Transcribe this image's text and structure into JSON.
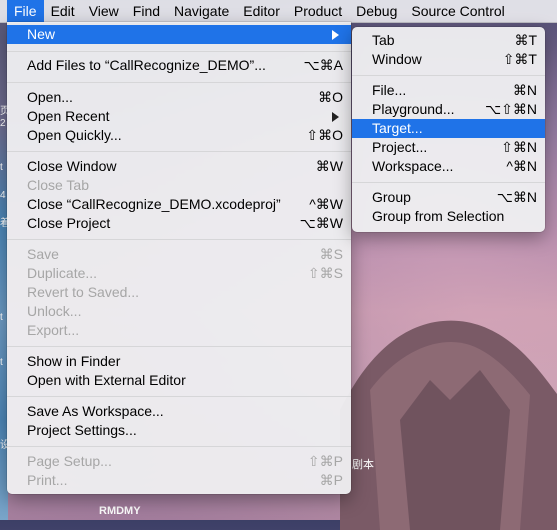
{
  "menubar": {
    "items": [
      "File",
      "Edit",
      "View",
      "Find",
      "Navigate",
      "Editor",
      "Product",
      "Debug",
      "Source Control"
    ]
  },
  "file_menu": {
    "new": "New",
    "add_files": {
      "label": "Add Files to “CallRecognize_DEMO”...",
      "shortcut": "⌥⌘A"
    },
    "open": {
      "label": "Open...",
      "shortcut": "⌘O"
    },
    "open_recent": {
      "label": "Open Recent"
    },
    "open_quickly": {
      "label": "Open Quickly...",
      "shortcut": "⇧⌘O"
    },
    "close_window": {
      "label": "Close Window",
      "shortcut": "⌘W"
    },
    "close_tab": {
      "label": "Close Tab"
    },
    "close_project_file": {
      "label": "Close “CallRecognize_DEMO.xcodeproj”",
      "shortcut": "^⌘W"
    },
    "close_project": {
      "label": "Close Project",
      "shortcut": "⌥⌘W"
    },
    "save": {
      "label": "Save",
      "shortcut": "⌘S"
    },
    "duplicate": {
      "label": "Duplicate...",
      "shortcut": "⇧⌘S"
    },
    "revert": {
      "label": "Revert to Saved..."
    },
    "unlock": {
      "label": "Unlock..."
    },
    "export": {
      "label": "Export..."
    },
    "show_in_finder": {
      "label": "Show in Finder"
    },
    "open_external": {
      "label": "Open with External Editor"
    },
    "save_workspace": {
      "label": "Save As Workspace..."
    },
    "project_settings": {
      "label": "Project Settings..."
    },
    "page_setup": {
      "label": "Page Setup...",
      "shortcut": "⇧⌘P"
    },
    "print": {
      "label": "Print...",
      "shortcut": "⌘P"
    }
  },
  "new_submenu": {
    "tab": {
      "label": "Tab",
      "shortcut": "⌘T"
    },
    "window": {
      "label": "Window",
      "shortcut": "⇧⌘T"
    },
    "file": {
      "label": "File...",
      "shortcut": "⌘N"
    },
    "playground": {
      "label": "Playground...",
      "shortcut": "⌥⇧⌘N"
    },
    "target": {
      "label": "Target..."
    },
    "project": {
      "label": "Project...",
      "shortcut": "⇧⌘N"
    },
    "workspace": {
      "label": "Workspace...",
      "shortcut": "^⌘N"
    },
    "group": {
      "label": "Group",
      "shortcut": "⌥⌘N"
    },
    "group_from_selection": {
      "label": "Group from Selection"
    }
  },
  "desktop": {
    "label": "RMDMY",
    "label2": "剧本",
    "left_chars": [
      "页",
      "2",
      "t",
      "4",
      "着",
      "t",
      "t",
      "设"
    ]
  },
  "colors": {
    "highlight": "#1f73e8",
    "disabled": "#a6a6a6"
  }
}
